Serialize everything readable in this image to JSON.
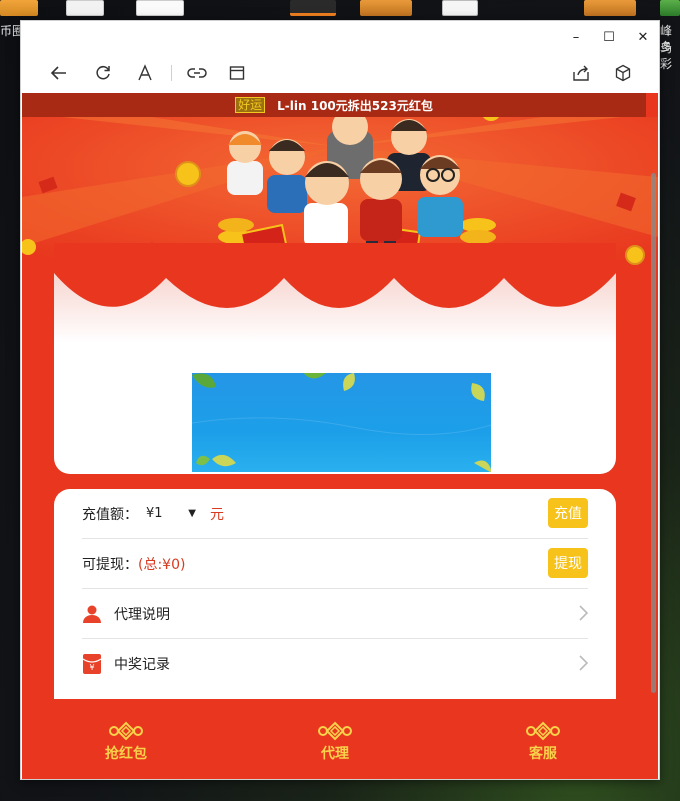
{
  "desktop": {
    "left_text": "币圈",
    "right_text_1": "峰鸟",
    "right_text_2": "多彩"
  },
  "window": {
    "controls": {
      "minimize": "–",
      "maximize": "☐",
      "close": "✕"
    }
  },
  "toolbar": {
    "icons": [
      "back-icon",
      "refresh-icon",
      "text-size-icon",
      "link-icon",
      "layout-icon",
      "share-icon",
      "cube-icon"
    ]
  },
  "notice": {
    "tag": "好运",
    "message": "L-lin 100元拆出523元红包"
  },
  "recharge": {
    "label": "充值额：",
    "selected_amount": "¥1",
    "unit": "元",
    "button": "充值"
  },
  "withdraw": {
    "label": "可提现：",
    "total": "(总:¥0)",
    "button": "提现"
  },
  "menu": [
    {
      "label": "代理说明",
      "icon": "user-icon"
    },
    {
      "label": "中奖记录",
      "icon": "red-envelope-icon"
    }
  ],
  "bottom_nav": [
    {
      "label": "抢红包",
      "icon": "chinese-knot-icon"
    },
    {
      "label": "代理",
      "icon": "chinese-knot-icon"
    },
    {
      "label": "客服",
      "icon": "chinese-knot-icon"
    }
  ],
  "colors": {
    "page_red": "#e8371e",
    "notice_bg": "#a82a14",
    "button_yellow": "#f7c21a",
    "nav_gold": "#f8d24a"
  }
}
